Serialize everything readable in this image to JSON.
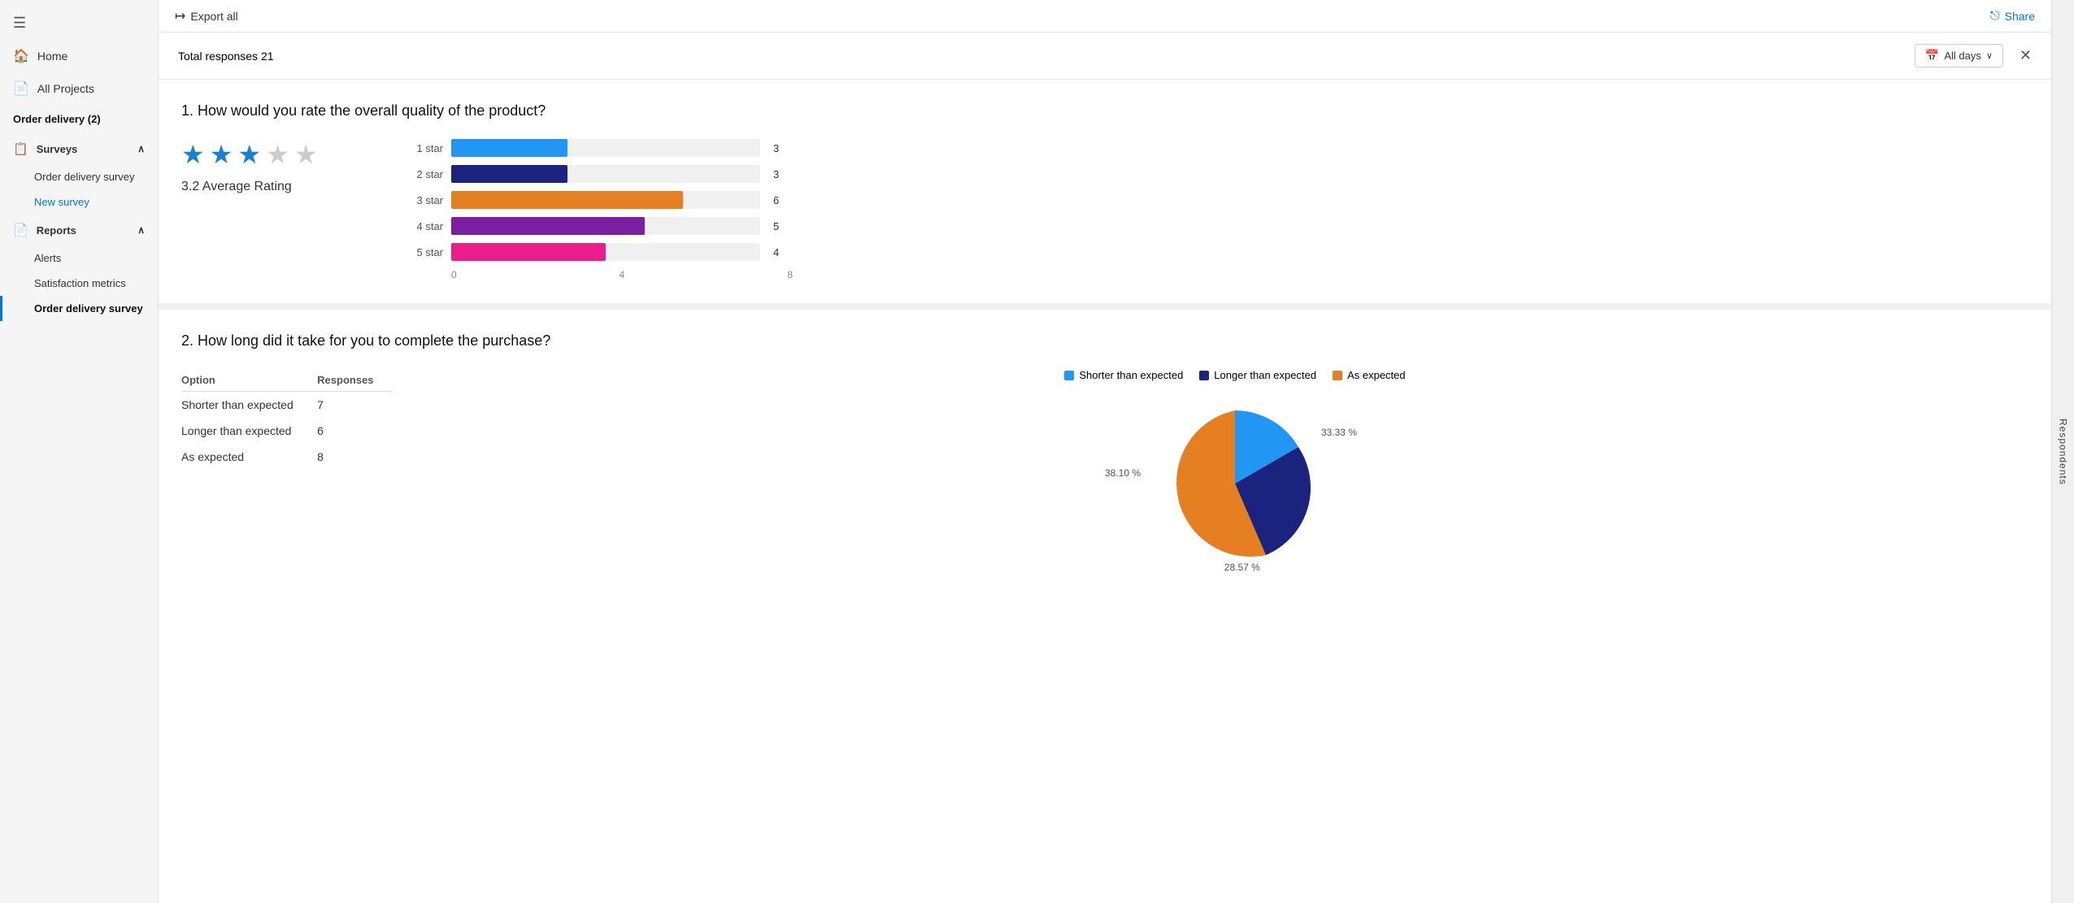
{
  "sidebar": {
    "menu_icon": "☰",
    "items": [
      {
        "label": "Home",
        "icon": "🏠"
      },
      {
        "label": "All Projects",
        "icon": "📄"
      }
    ],
    "group_title": "Order delivery (2)",
    "surveys_label": "Surveys",
    "survey_items": [
      {
        "label": "Order delivery survey"
      },
      {
        "label": "New survey",
        "active_blue": true
      }
    ],
    "reports_label": "Reports",
    "report_items": [
      {
        "label": "Alerts"
      },
      {
        "label": "Satisfaction metrics"
      },
      {
        "label": "Order delivery survey",
        "active_selected": true
      }
    ]
  },
  "toolbar": {
    "export_label": "Export all",
    "share_label": "Share"
  },
  "content_header": {
    "total_responses": "Total responses 21",
    "all_days": "All days"
  },
  "q1": {
    "title": "1. How would you rate the overall quality of the product?",
    "avg_rating_label": "3.2 Average Rating",
    "stars": [
      true,
      true,
      true,
      false,
      false
    ],
    "bars": [
      {
        "label": "1 star",
        "value": 3,
        "max": 8,
        "color": "#2196f3"
      },
      {
        "label": "2 star",
        "value": 3,
        "max": 8,
        "color": "#1a237e"
      },
      {
        "label": "3 star",
        "value": 6,
        "max": 8,
        "color": "#e67e22"
      },
      {
        "label": "4 star",
        "value": 5,
        "max": 8,
        "color": "#7b1fa2"
      },
      {
        "label": "5 star",
        "value": 4,
        "max": 8,
        "color": "#e91e8c"
      }
    ],
    "axis_labels": [
      "0",
      "4",
      "8"
    ]
  },
  "q2": {
    "title": "2. How long did it take for you to complete the purchase?",
    "table_headers": [
      "Option",
      "Responses"
    ],
    "rows": [
      {
        "option": "Shorter than expected",
        "responses": "7"
      },
      {
        "option": "Longer than expected",
        "responses": "6"
      },
      {
        "option": "As expected",
        "responses": "8"
      }
    ],
    "legend": [
      {
        "label": "Shorter than expected",
        "color": "#2196f3"
      },
      {
        "label": "Longer than expected",
        "color": "#1a237e"
      },
      {
        "label": "As expected",
        "color": "#e67e22"
      }
    ],
    "pie_labels": [
      {
        "text": "33.33 %",
        "side": "right"
      },
      {
        "text": "28.57 %",
        "side": "bottom"
      },
      {
        "text": "38.10 %",
        "side": "left"
      }
    ]
  },
  "respondents_tab": "Respondents"
}
